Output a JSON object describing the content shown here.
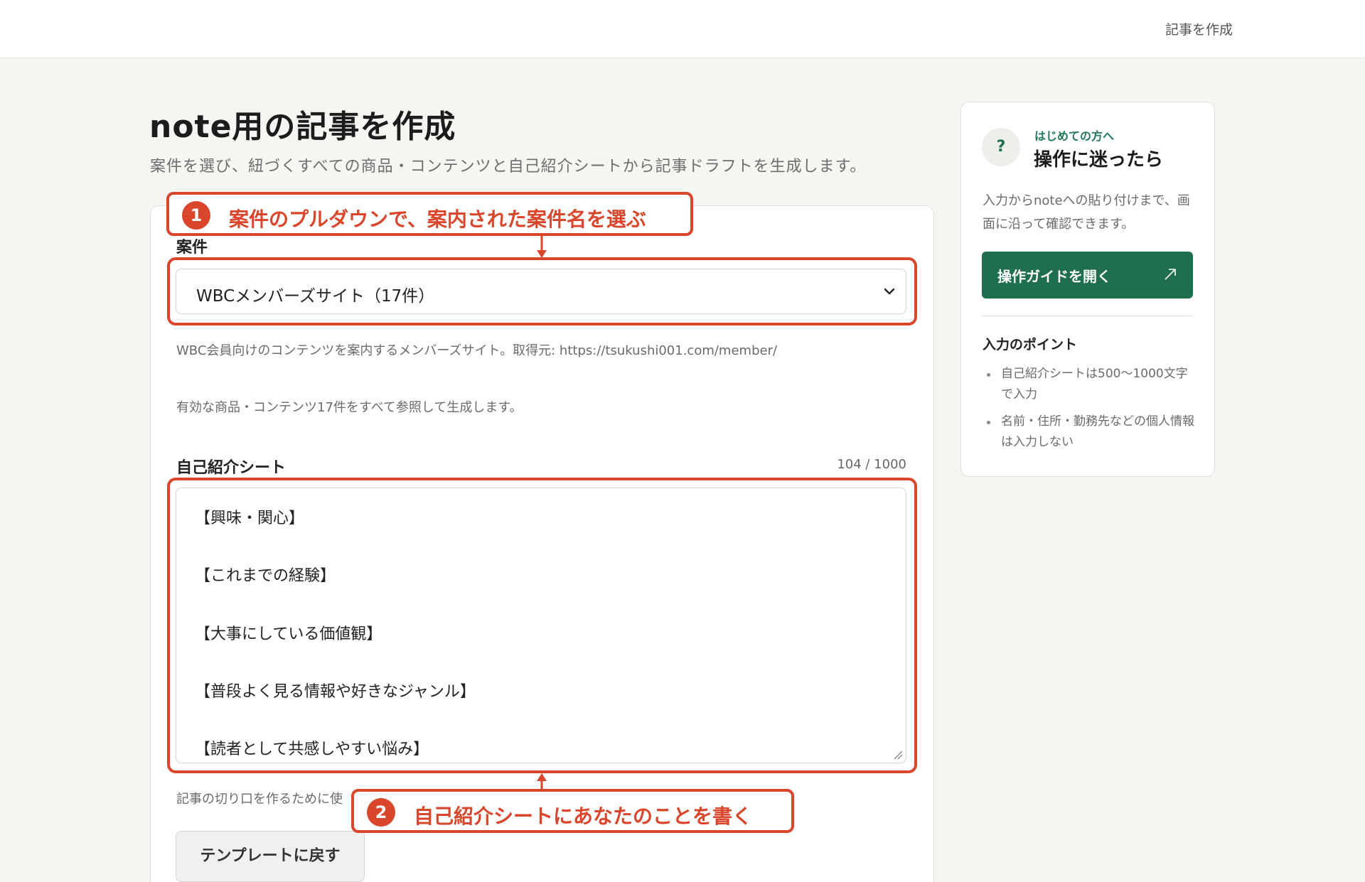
{
  "header": {
    "nav_link": "記事を作成"
  },
  "page": {
    "title": "note用の記事を作成",
    "subtitle": "案件を選び、紐づくすべての商品・コンテンツと自己紹介シートから記事ドラフトを生成します。"
  },
  "form": {
    "project_label": "案件",
    "project_selected": "WBCメンバーズサイト（17件）",
    "project_description": "WBC会員向けのコンテンツを案内するメンバーズサイト。取得元: https://tsukushi001.com/member/",
    "project_note": "有効な商品・コンテンツ17件をすべて参照して生成します。",
    "sheet_label": "自己紹介シート",
    "sheet_counter": "104 / 1000",
    "sheet_lines": [
      "【興味・関心】",
      "【これまでの経験】",
      "【大事にしている価値観】",
      "【普段よく見る情報や好きなジャンル】",
      "【読者として共感しやすい悩み】"
    ],
    "sheet_help": "記事の切り口を作るために使",
    "reset_button": "テンプレートに戻す"
  },
  "annotations": [
    {
      "number": "1",
      "text": "案件のプルダウンで、案内された案件名を選ぶ"
    },
    {
      "number": "2",
      "text": "自己紹介シートにあなたのことを書く"
    }
  ],
  "sidebar": {
    "icon": "question-icon",
    "icon_glyph": "?",
    "eyebrow": "はじめての方へ",
    "title": "操作に迷ったら",
    "description": "入力からnoteへの貼り付けまで、画面に沿って確認できます。",
    "guide_button": "操作ガイドを開く",
    "tips_title": "入力のポイント",
    "tips": [
      "自己紹介シートは500〜1000文字で入力",
      "名前・住所・勤務先などの個人情報は入力しない"
    ]
  },
  "colors": {
    "accent_green": "#1f6f4f",
    "annotation_red": "#d9462c",
    "background": "#f5f5f2"
  }
}
